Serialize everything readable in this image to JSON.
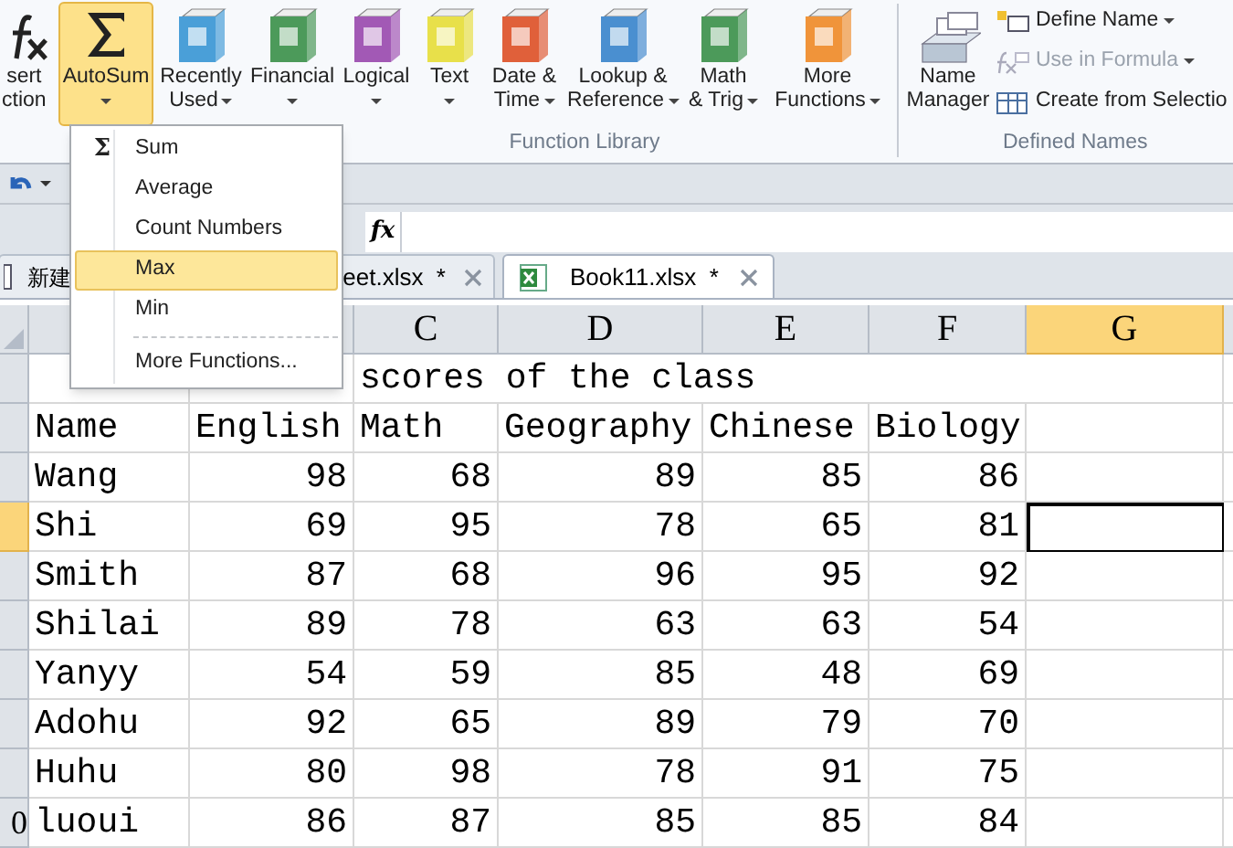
{
  "ribbon": {
    "function_library": {
      "label": "Function Library",
      "buttons": [
        {
          "kind": "fx",
          "lines": [
            "sert",
            "ction"
          ],
          "dropdown": false,
          "selected": false
        },
        {
          "kind": "sigma",
          "lines": [
            "AutoSum"
          ],
          "dropdown": true,
          "selected": true
        },
        {
          "kind": "book",
          "color": "#4a9fd8",
          "lines": [
            "Recently",
            "Used"
          ],
          "dropdown": true,
          "selected": false
        },
        {
          "kind": "book",
          "color": "#4c9a5a",
          "lines": [
            "Financial"
          ],
          "dropdown": true,
          "selected": false
        },
        {
          "kind": "book",
          "color": "#a259b5",
          "lines": [
            "Logical"
          ],
          "dropdown": true,
          "selected": false
        },
        {
          "kind": "book",
          "color": "#e8e04a",
          "lines": [
            "Text"
          ],
          "dropdown": true,
          "selected": false
        },
        {
          "kind": "book",
          "color": "#e0603a",
          "lines": [
            "Date &",
            "Time"
          ],
          "dropdown": true,
          "selected": false
        },
        {
          "kind": "book",
          "color": "#4a8fd0",
          "lines": [
            "Lookup &",
            "Reference"
          ],
          "dropdown": true,
          "selected": false
        },
        {
          "kind": "book",
          "color": "#4c9a5a",
          "lines": [
            "Math",
            "& Trig"
          ],
          "dropdown": true,
          "selected": false
        },
        {
          "kind": "book",
          "color": "#f0943a",
          "lines": [
            "More",
            "Functions"
          ],
          "dropdown": true,
          "selected": false
        }
      ]
    },
    "defined_names": {
      "label": "Defined Names",
      "name_manager": [
        "Name",
        "Manager"
      ],
      "items": [
        {
          "label": "Define Name",
          "dropdown": true,
          "disabled": false
        },
        {
          "label": "Use in Formula",
          "dropdown": true,
          "disabled": true
        },
        {
          "label": "Create from Selectio",
          "dropdown": false,
          "disabled": false
        }
      ]
    }
  },
  "autosum_menu": [
    {
      "label": "Sum",
      "selected": false,
      "icon": "Σ"
    },
    {
      "label": "Average",
      "selected": false
    },
    {
      "label": "Count Numbers",
      "selected": false
    },
    {
      "label": "Max",
      "selected": true
    },
    {
      "label": "Min",
      "selected": false
    },
    {
      "label": "More Functions...",
      "selected": false,
      "separator_before": true
    }
  ],
  "formula_bar": {
    "fx": "fx"
  },
  "tabs": [
    {
      "left": "新建",
      "right": "eet.xlsx  *",
      "selected": false
    },
    {
      "label": "Book11.xlsx  *",
      "selected": true
    }
  ],
  "sheet": {
    "columns": [
      {
        "selected": false
      },
      {
        "selected": false
      },
      {
        "label": "C",
        "selected": false
      },
      {
        "label": "D",
        "selected": false
      },
      {
        "label": "E",
        "selected": false
      },
      {
        "label": "F",
        "selected": false
      },
      {
        "label": "G",
        "selected": true
      }
    ],
    "title": "scores of the class",
    "header_row": [
      "Name",
      "English",
      "Math",
      "Geography",
      "Chinese",
      "Biology"
    ],
    "rows": [
      {
        "selected": false,
        "cells": [
          "Wang",
          "98",
          "68",
          "89",
          "85",
          "86"
        ]
      },
      {
        "selected": true,
        "cells": [
          "Shi",
          "69",
          "95",
          "78",
          "65",
          "81"
        ]
      },
      {
        "selected": false,
        "cells": [
          "Smith",
          "87",
          "68",
          "96",
          "95",
          "92"
        ]
      },
      {
        "selected": false,
        "cells": [
          "Shilai",
          "89",
          "78",
          "63",
          "63",
          "54"
        ]
      },
      {
        "selected": false,
        "cells": [
          "Yanyy",
          "54",
          "59",
          "85",
          "48",
          "69"
        ]
      },
      {
        "selected": false,
        "cells": [
          "Adohu",
          "92",
          "65",
          "89",
          "79",
          "70"
        ]
      },
      {
        "selected": false,
        "cells": [
          "Huhu",
          "80",
          "98",
          "78",
          "91",
          "75"
        ]
      },
      {
        "selected": false,
        "row_label": "0",
        "cells": [
          "luoui",
          "86",
          "87",
          "85",
          "85",
          "84"
        ]
      }
    ]
  }
}
